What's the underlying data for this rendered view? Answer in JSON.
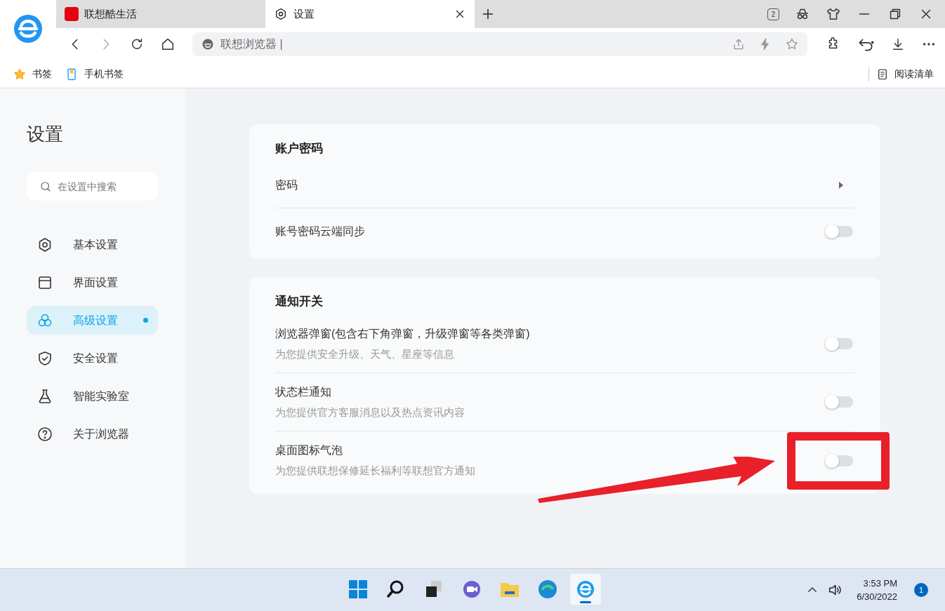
{
  "tabs": [
    {
      "title": "联想酷生活",
      "selected": false,
      "kind": "site"
    },
    {
      "title": "设置",
      "selected": true,
      "kind": "settings"
    }
  ],
  "tab_badge": "2",
  "address_bar": {
    "site_name": "联想浏览器 |"
  },
  "bookmarks": [
    {
      "label": "书签",
      "kind": "star"
    },
    {
      "label": "手机书签",
      "kind": "phone"
    }
  ],
  "reading_list": "阅读清单",
  "sidebar": {
    "title": "设置",
    "search": {
      "placeholder": "在设置中搜索"
    },
    "items": [
      {
        "label": "基本设置",
        "kind": "gear",
        "selected": false
      },
      {
        "label": "界面设置",
        "kind": "window",
        "selected": false
      },
      {
        "label": "高级设置",
        "kind": "circles",
        "selected": true
      },
      {
        "label": "安全设置",
        "kind": "shield",
        "selected": false
      },
      {
        "label": "智能实验室",
        "kind": "flask",
        "selected": false
      },
      {
        "label": "关于浏览器",
        "kind": "help",
        "selected": false
      }
    ]
  },
  "sections": [
    {
      "title": "账户密码",
      "rows": [
        {
          "kind": "link",
          "label": "密码"
        },
        {
          "kind": "toggle",
          "label": "账号密码云端同步",
          "on": false
        }
      ]
    },
    {
      "title": "通知开关",
      "rows": [
        {
          "kind": "toggle",
          "label": "浏览器弹窗(包含右下角弹窗，升级弹窗等各类弹窗)",
          "description": "为您提供安全升级、天气、星座等信息",
          "on": false
        },
        {
          "kind": "toggle",
          "label": "状态栏通知",
          "description": "为您提供官方客服消息以及热点资讯内容",
          "on": false
        },
        {
          "kind": "toggle",
          "label": "桌面图标气泡",
          "description": "为您提供联想保修延长福利等联想官方通知",
          "on": false,
          "highlighted": true
        }
      ]
    }
  ],
  "taskbar": {
    "time": "3:53 PM",
    "date": "6/30/2022",
    "notification_count": "1"
  }
}
